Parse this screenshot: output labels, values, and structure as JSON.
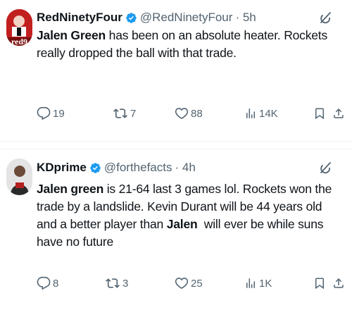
{
  "tweets": [
    {
      "display_name": "RedNinetyFour",
      "handle": "@RedNinetyFour",
      "time": "· 5h",
      "avatar_text": "red9",
      "text_bold": "Jalen Green",
      "text_rest": " has been on an absolute heater. Rockets really dropped the ball with that trade.",
      "replies": "19",
      "reposts": "7",
      "likes": "88",
      "views": "14K"
    },
    {
      "display_name": "KDprime",
      "handle": "@forthefacts",
      "time": "· 4h",
      "text_parts": [
        {
          "text": "Jalen green",
          "bold": true
        },
        {
          "text": " is 21-64 last 3 games lol. Rockets won the trade by a landslide. Kevin Durant will be 44 years old and a better player than ",
          "bold": false
        },
        {
          "text": "Jalen",
          "bold": true
        },
        {
          "text": "  will ever be while suns have no future",
          "bold": false
        }
      ],
      "replies": "8",
      "reposts": "3",
      "likes": "25",
      "views": "1K"
    }
  ],
  "icons": {
    "verified": "verified-badge-icon",
    "grok": "grok-icon",
    "reply": "reply-icon",
    "repost": "repost-icon",
    "like": "heart-icon",
    "views": "views-icon",
    "bookmark": "bookmark-icon",
    "share": "share-icon"
  },
  "colors": {
    "verified": "#1d9bf0",
    "secondary_text": "#536471",
    "primary_text": "#0f1419"
  }
}
